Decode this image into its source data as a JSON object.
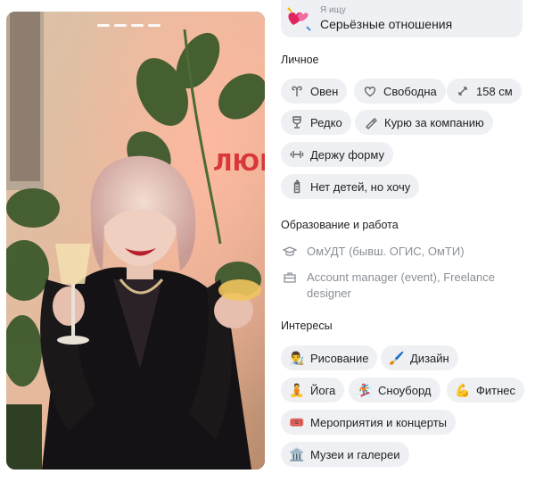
{
  "looking_for": {
    "label": "Я ищу",
    "value": "Серьёзные отношения",
    "icon": "hearts-icon"
  },
  "personal": {
    "title": "Личное",
    "chips": [
      {
        "icon": "aries-icon",
        "label": "Овен"
      },
      {
        "icon": "heart-outline-icon",
        "label": "Свободна"
      },
      {
        "icon": "height-arrows-icon",
        "label": "158 см"
      },
      {
        "icon": "wine-glass-icon",
        "label": "Редко"
      },
      {
        "icon": "cigarette-icon",
        "label": "Курю за компанию"
      },
      {
        "icon": "dumbbell-icon",
        "label": "Держу форму"
      },
      {
        "icon": "baby-bottle-icon",
        "label": "Нет детей, но хочу"
      }
    ]
  },
  "education_work": {
    "title": "Образование и работа",
    "education": {
      "icon": "graduation-cap-icon",
      "text": "ОмУДТ (бывш. ОГИС, ОмТИ)"
    },
    "work": {
      "icon": "briefcase-icon",
      "text": "Account manager (event), Freelance designer"
    }
  },
  "interests": {
    "title": "Интересы",
    "chips": [
      {
        "emoji": "👨‍🎨",
        "label": "Рисование"
      },
      {
        "emoji": "🖌️",
        "label": "Дизайн"
      },
      {
        "emoji": "🧘",
        "label": "Йога"
      },
      {
        "emoji": "🏂",
        "label": "Сноуборд"
      },
      {
        "emoji": "💪",
        "label": "Фитнес"
      },
      {
        "emoji": "🎟️",
        "label": "Мероприятия и концерты"
      },
      {
        "emoji": "🏛️",
        "label": "Музеи и галереи"
      }
    ]
  },
  "photo": {
    "sign_text": "ЛЮБО",
    "story_segments": 4
  },
  "colors": {
    "chip_bg": "#eef0f3",
    "muted_text": "#8a8f96",
    "neon_sign": "#d8383a"
  }
}
